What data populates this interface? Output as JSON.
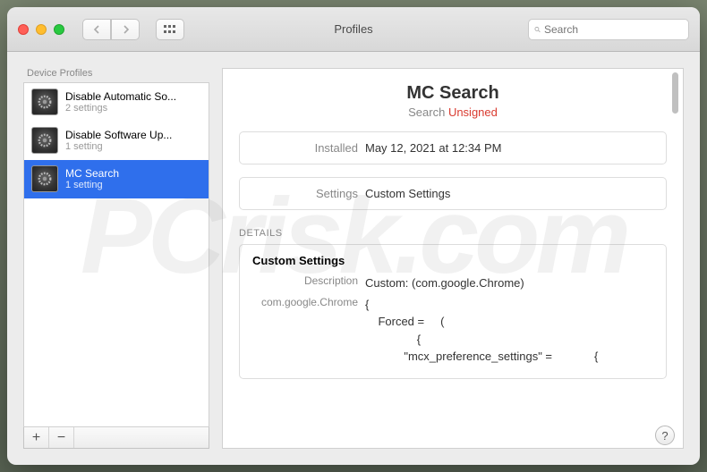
{
  "window": {
    "title": "Profiles",
    "search_placeholder": "Search"
  },
  "sidebar": {
    "header": "Device Profiles",
    "items": [
      {
        "title": "Disable Automatic So...",
        "sub": "2 settings"
      },
      {
        "title": "Disable Software Up...",
        "sub": "1 setting"
      },
      {
        "title": "MC Search",
        "sub": "1 setting"
      }
    ],
    "selected_index": 2,
    "add_label": "+",
    "remove_label": "−"
  },
  "profile": {
    "name": "MC Search",
    "category": "Search",
    "signed_status": "Unsigned",
    "installed_label": "Installed",
    "installed_value": "May 12, 2021 at 12:34 PM",
    "settings_label": "Settings",
    "settings_value": "Custom Settings",
    "details_label": "DETAILS"
  },
  "details": {
    "heading": "Custom Settings",
    "rows": [
      {
        "key": "Description",
        "val": "Custom: (com.google.Chrome)"
      },
      {
        "key": "com.google.Chrome",
        "val": "{\n    Forced =     (\n                {\n            \"mcx_preference_settings\" =             {"
      }
    ]
  },
  "help": {
    "label": "?"
  },
  "watermark": "PCrisk.com"
}
